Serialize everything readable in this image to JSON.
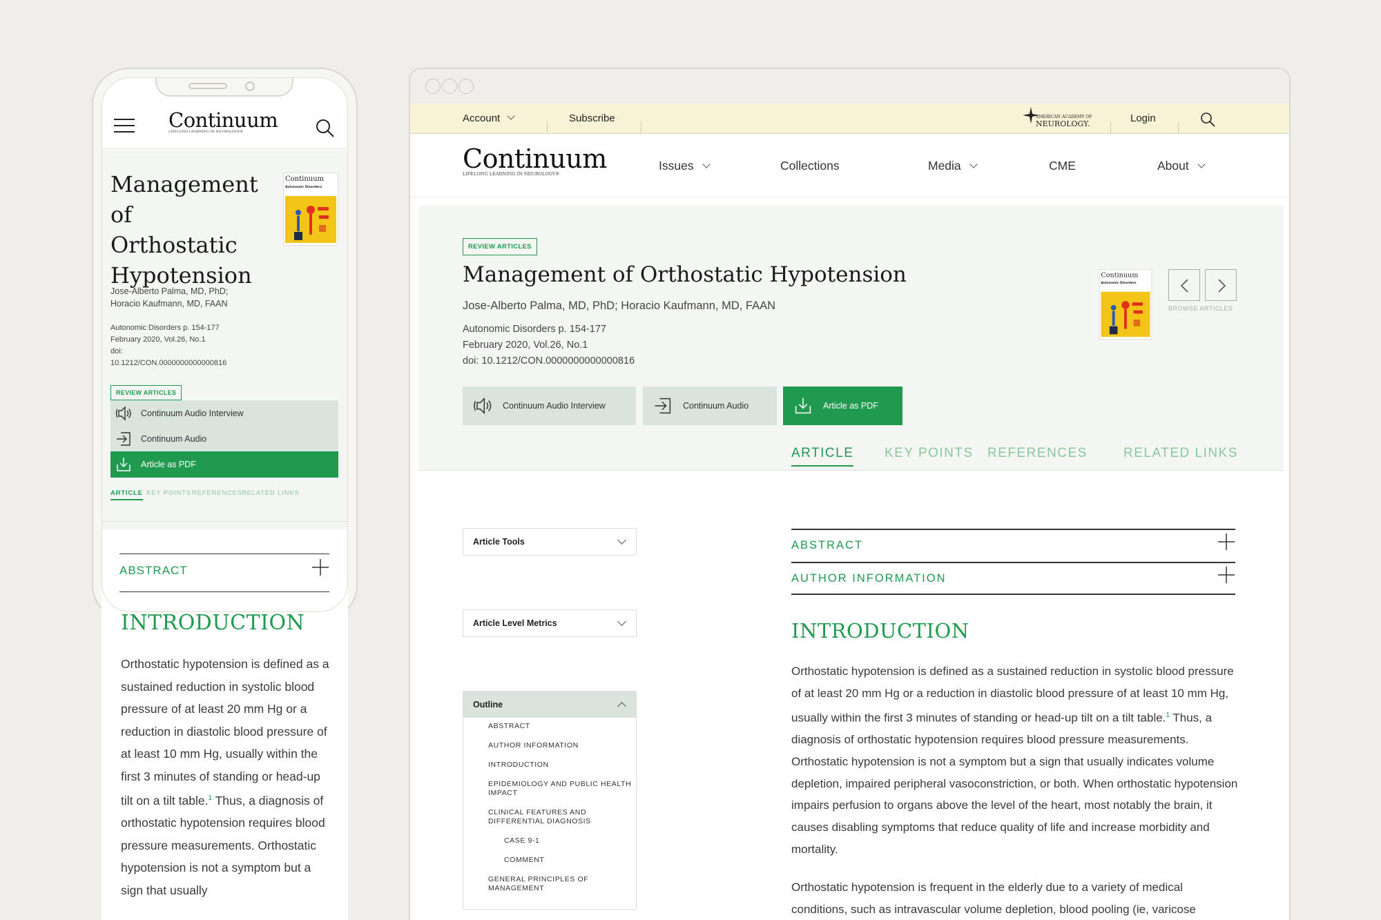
{
  "brand": {
    "logo_word": "Continuum",
    "logo_tagline": "Lifelong Learning in Neurology®",
    "aan_logo_line1": "American Academy of",
    "aan_logo_line2": "Neurology."
  },
  "colors": {
    "accent": "#1f9a4f",
    "utility_bar": "#f8f3d6",
    "hero_bg": "#f4f6f4",
    "button_bg": "#d9e4dc"
  },
  "utility_bar": {
    "account": "Account",
    "subscribe": "Subscribe",
    "login": "Login"
  },
  "main_nav": {
    "issues": "Issues",
    "collections": "Collections",
    "media": "Media",
    "cme": "CME",
    "about": "About"
  },
  "article": {
    "category": "REVIEW ARTICLES",
    "title": "Management of Orthostatic Hypotension",
    "authors": "Jose-Alberto Palma, MD, PhD; Horacio Kaufmann, MD, FAAN",
    "authors_line1": "Jose-Alberto Palma, MD, PhD;",
    "authors_line2": "Horacio Kaufmann, MD, FAAN",
    "issue_pages": "Autonomic Disorders p. 154-177",
    "issue_date": "February 2020, Vol.26, No.1",
    "doi": "doi: 10.1212/CON.0000000000000816",
    "doi_label": "doi:",
    "doi_value": "10.1212/CON.0000000000000816"
  },
  "cover": {
    "title": "Continuum",
    "subtitle": "Autonomic Disorders"
  },
  "buttons": {
    "audio_interview": "Continuum Audio Interview",
    "audio": "Continuum Audio",
    "pdf": "Article as PDF"
  },
  "browse_label": "BROWSE ARTICLES",
  "tabs": {
    "article": "ARTICLE",
    "key_points": "KEY POINTS",
    "references": "REFERENCES",
    "related_links": "RELATED LINKS"
  },
  "sidebar": {
    "article_tools": "Article Tools",
    "article_level_metrics": "Article Level Metrics",
    "outline_title": "Outline",
    "outline_items": [
      {
        "label": "ABSTRACT"
      },
      {
        "label": "AUTHOR INFORMATION"
      },
      {
        "label": "INTRODUCTION"
      },
      {
        "label": "EPIDEMIOLOGY AND PUBLIC HEALTH IMPACT"
      },
      {
        "label": "CLINICAL FEATURES AND DIFFERENTIAL DIAGNOSIS"
      },
      {
        "label": "CASE 9-1"
      },
      {
        "label": "COMMENT"
      },
      {
        "label": "GENERAL PRINCIPLES OF MANAGEMENT"
      }
    ]
  },
  "accordions": {
    "abstract": "ABSTRACT",
    "author_information": "AUTHOR INFORMATION"
  },
  "body": {
    "intro_heading": "INTRODUCTION",
    "para1_a": "Orthostatic hypotension is defined as a sustained reduction in systolic blood pressure of at least 20 mm Hg or a reduction in diastolic blood pressure of at least 10 mm Hg, usually within the first 3 minutes of standing or head-up tilt on a tilt table.",
    "para1_sup": "1",
    "para1_b": " Thus, a diagnosis of orthostatic hypotension requires blood pressure measurements. Orthostatic hypotension is not a symptom but a sign that usually indicates volume depletion, impaired peripheral vasoconstriction, or both. When orthostatic hypotension impairs perfusion to organs above the level of the heart, most notably the brain, it causes disabling symptoms that reduce quality of life and increase morbidity and mortality.",
    "para2": "Orthostatic hypotension is frequent in the elderly due to a variety of medical conditions, such as intravascular volume depletion, blood pooling (ie, varicose",
    "mobile_para1_b": " Thus, a diagnosis of orthostatic hypotension requires blood pressure measurements. Orthostatic hypotension is not a symptom but a sign that usually"
  }
}
